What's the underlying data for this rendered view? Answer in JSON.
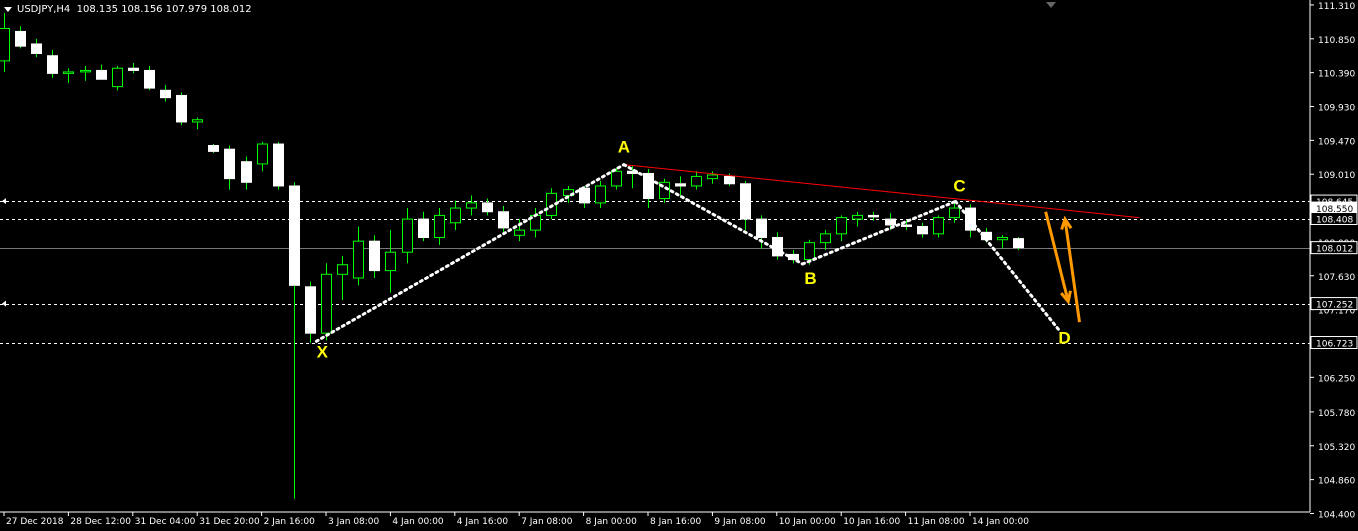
{
  "header": {
    "symbol": "USDJPY,H4",
    "ohlc": "108.135 108.156 107.979 108.012"
  },
  "colors": {
    "background": "#000000",
    "bull_fill": "#000000",
    "bull_outline": "#00ff00",
    "bear_fill": "#ffffff",
    "bear_outline": "#ffffff",
    "wick": "#00ff00",
    "pattern_dots": "#ffffff",
    "pattern_label": "#ffff00",
    "trendline": "#ff0000",
    "arrows": "#ff9900",
    "price_level_line": "#ffffff",
    "bid_line": "#777777",
    "axis_text": "#ffffff"
  },
  "chart_data": {
    "type": "candlestick",
    "symbol": "USDJPY",
    "timeframe": "H4",
    "ylim": [
      104.42,
      111.35
    ],
    "y_ticks": [
      "111.310",
      "110.850",
      "110.390",
      "109.930",
      "109.470",
      "109.010",
      "108.550",
      "108.090",
      "107.630",
      "107.170",
      "106.710",
      "106.250",
      "105.780",
      "105.320",
      "104.860",
      "104.400"
    ],
    "x_tick_labels": [
      "27 Dec 2018",
      "28 Dec 12:00",
      "31 Dec 04:00",
      "31 Dec 20:00",
      "2 Jan 16:00",
      "3 Jan 08:00",
      "4 Jan 00:00",
      "4 Jan 16:00",
      "7 Jan 08:00",
      "8 Jan 00:00",
      "8 Jan 16:00",
      "9 Jan 08:00",
      "10 Jan 00:00",
      "10 Jan 16:00",
      "11 Jan 08:00",
      "14 Jan 00:00"
    ],
    "price_labels": [
      "108.645",
      "108.550",
      "108.408",
      "108.012",
      "107.252",
      "106.723"
    ],
    "horizontal_levels": [
      108.645,
      108.408,
      107.252,
      106.723
    ],
    "bid": 108.012,
    "candles": [
      {
        "i": 0,
        "o": 110.55,
        "h": 111.2,
        "l": 110.4,
        "c": 110.99
      },
      {
        "i": 1,
        "o": 110.95,
        "h": 111.02,
        "l": 110.72,
        "c": 110.75
      },
      {
        "i": 2,
        "o": 110.78,
        "h": 110.85,
        "l": 110.6,
        "c": 110.65
      },
      {
        "i": 3,
        "o": 110.62,
        "h": 110.7,
        "l": 110.32,
        "c": 110.38
      },
      {
        "i": 4,
        "o": 110.38,
        "h": 110.45,
        "l": 110.25,
        "c": 110.4
      },
      {
        "i": 5,
        "o": 110.4,
        "h": 110.48,
        "l": 110.28,
        "c": 110.42
      },
      {
        "i": 6,
        "o": 110.42,
        "h": 110.5,
        "l": 110.3,
        "c": 110.3
      },
      {
        "i": 7,
        "o": 110.2,
        "h": 110.48,
        "l": 110.15,
        "c": 110.45
      },
      {
        "i": 8,
        "o": 110.45,
        "h": 110.52,
        "l": 110.38,
        "c": 110.42
      },
      {
        "i": 9,
        "o": 110.42,
        "h": 110.48,
        "l": 110.15,
        "c": 110.18
      },
      {
        "i": 10,
        "o": 110.15,
        "h": 110.22,
        "l": 110.0,
        "c": 110.05
      },
      {
        "i": 11,
        "o": 110.08,
        "h": 110.12,
        "l": 109.68,
        "c": 109.72
      },
      {
        "i": 12,
        "o": 109.72,
        "h": 109.78,
        "l": 109.62,
        "c": 109.75
      },
      {
        "i": 13,
        "o": 109.4,
        "h": 109.42,
        "l": 109.3,
        "c": 109.32
      },
      {
        "i": 14,
        "o": 109.35,
        "h": 109.4,
        "l": 108.8,
        "c": 108.95
      },
      {
        "i": 15,
        "o": 109.18,
        "h": 109.25,
        "l": 108.8,
        "c": 108.9
      },
      {
        "i": 16,
        "o": 109.15,
        "h": 109.45,
        "l": 109.05,
        "c": 109.42
      },
      {
        "i": 17,
        "o": 109.42,
        "h": 109.45,
        "l": 108.8,
        "c": 108.85
      },
      {
        "i": 18,
        "o": 108.85,
        "h": 108.9,
        "l": 104.6,
        "c": 107.5
      },
      {
        "i": 19,
        "o": 107.48,
        "h": 107.55,
        "l": 106.72,
        "c": 106.85
      },
      {
        "i": 20,
        "o": 106.85,
        "h": 107.8,
        "l": 106.75,
        "c": 107.65
      },
      {
        "i": 21,
        "o": 107.65,
        "h": 107.9,
        "l": 107.3,
        "c": 107.78
      },
      {
        "i": 22,
        "o": 107.6,
        "h": 108.3,
        "l": 107.5,
        "c": 108.1
      },
      {
        "i": 23,
        "o": 108.1,
        "h": 108.18,
        "l": 107.6,
        "c": 107.7
      },
      {
        "i": 24,
        "o": 107.7,
        "h": 108.25,
        "l": 107.4,
        "c": 107.95
      },
      {
        "i": 25,
        "o": 107.95,
        "h": 108.55,
        "l": 107.8,
        "c": 108.4
      },
      {
        "i": 26,
        "o": 108.4,
        "h": 108.5,
        "l": 108.1,
        "c": 108.15
      },
      {
        "i": 27,
        "o": 108.15,
        "h": 108.55,
        "l": 108.05,
        "c": 108.45
      },
      {
        "i": 28,
        "o": 108.35,
        "h": 108.65,
        "l": 108.25,
        "c": 108.55
      },
      {
        "i": 29,
        "o": 108.55,
        "h": 108.72,
        "l": 108.45,
        "c": 108.62
      },
      {
        "i": 30,
        "o": 108.62,
        "h": 108.68,
        "l": 108.45,
        "c": 108.5
      },
      {
        "i": 31,
        "o": 108.5,
        "h": 108.58,
        "l": 108.22,
        "c": 108.28
      },
      {
        "i": 32,
        "o": 108.18,
        "h": 108.4,
        "l": 108.1,
        "c": 108.25
      },
      {
        "i": 33,
        "o": 108.25,
        "h": 108.55,
        "l": 108.15,
        "c": 108.45
      },
      {
        "i": 34,
        "o": 108.45,
        "h": 108.82,
        "l": 108.4,
        "c": 108.75
      },
      {
        "i": 35,
        "o": 108.72,
        "h": 108.85,
        "l": 108.62,
        "c": 108.8
      },
      {
        "i": 36,
        "o": 108.82,
        "h": 108.85,
        "l": 108.55,
        "c": 108.62
      },
      {
        "i": 37,
        "o": 108.62,
        "h": 108.92,
        "l": 108.55,
        "c": 108.85
      },
      {
        "i": 38,
        "o": 108.85,
        "h": 109.1,
        "l": 108.8,
        "c": 109.05
      },
      {
        "i": 39,
        "o": 109.05,
        "h": 109.12,
        "l": 108.82,
        "c": 109.02
      },
      {
        "i": 40,
        "o": 109.02,
        "h": 109.08,
        "l": 108.55,
        "c": 108.68
      },
      {
        "i": 41,
        "o": 108.68,
        "h": 108.95,
        "l": 108.62,
        "c": 108.9
      },
      {
        "i": 42,
        "o": 108.88,
        "h": 108.98,
        "l": 108.72,
        "c": 108.85
      },
      {
        "i": 43,
        "o": 108.85,
        "h": 109.05,
        "l": 108.8,
        "c": 108.98
      },
      {
        "i": 44,
        "o": 108.95,
        "h": 109.05,
        "l": 108.88,
        "c": 109.0
      },
      {
        "i": 45,
        "o": 108.98,
        "h": 109.02,
        "l": 108.85,
        "c": 108.88
      },
      {
        "i": 46,
        "o": 108.88,
        "h": 108.92,
        "l": 108.25,
        "c": 108.4
      },
      {
        "i": 47,
        "o": 108.4,
        "h": 108.45,
        "l": 108.0,
        "c": 108.15
      },
      {
        "i": 48,
        "o": 108.15,
        "h": 108.22,
        "l": 107.85,
        "c": 107.9
      },
      {
        "i": 49,
        "o": 107.92,
        "h": 107.98,
        "l": 107.8,
        "c": 107.85
      },
      {
        "i": 50,
        "o": 107.85,
        "h": 108.12,
        "l": 107.78,
        "c": 108.08
      },
      {
        "i": 51,
        "o": 108.08,
        "h": 108.25,
        "l": 107.98,
        "c": 108.2
      },
      {
        "i": 52,
        "o": 108.2,
        "h": 108.45,
        "l": 108.1,
        "c": 108.42
      },
      {
        "i": 53,
        "o": 108.4,
        "h": 108.5,
        "l": 108.3,
        "c": 108.45
      },
      {
        "i": 54,
        "o": 108.45,
        "h": 108.5,
        "l": 108.38,
        "c": 108.43
      },
      {
        "i": 55,
        "o": 108.4,
        "h": 108.48,
        "l": 108.25,
        "c": 108.32
      },
      {
        "i": 56,
        "o": 108.32,
        "h": 108.38,
        "l": 108.25,
        "c": 108.3
      },
      {
        "i": 57,
        "o": 108.3,
        "h": 108.35,
        "l": 108.15,
        "c": 108.2
      },
      {
        "i": 58,
        "o": 108.2,
        "h": 108.45,
        "l": 108.15,
        "c": 108.42
      },
      {
        "i": 59,
        "o": 108.42,
        "h": 108.62,
        "l": 108.35,
        "c": 108.55
      },
      {
        "i": 60,
        "o": 108.55,
        "h": 108.6,
        "l": 108.15,
        "c": 108.25
      },
      {
        "i": 61,
        "o": 108.22,
        "h": 108.28,
        "l": 108.08,
        "c": 108.12
      },
      {
        "i": 62,
        "o": 108.12,
        "h": 108.18,
        "l": 108.0,
        "c": 108.15
      },
      {
        "i": 63,
        "o": 108.135,
        "h": 108.156,
        "l": 107.979,
        "c": 108.012
      }
    ],
    "pattern": {
      "name": "XABCD",
      "points": [
        {
          "label": "X",
          "i": 19.4,
          "price": 106.74
        },
        {
          "label": "A",
          "i": 38.5,
          "price": 109.14
        },
        {
          "label": "B",
          "i": 49.6,
          "price": 107.79
        },
        {
          "label": "C",
          "i": 59.1,
          "price": 108.64
        },
        {
          "label": "D",
          "i": 65.5,
          "price": 106.9
        }
      ]
    },
    "trendline": {
      "from": {
        "i": 38.5,
        "price": 109.14
      },
      "to": {
        "i": 70.5,
        "price": 108.42
      }
    },
    "arrows": [
      {
        "from": {
          "i": 64.7,
          "price": 108.5
        },
        "to": {
          "i": 66.1,
          "price": 107.28
        },
        "direction": "down"
      },
      {
        "from": {
          "i": 66.8,
          "price": 107.0
        },
        "to": {
          "i": 65.9,
          "price": 108.4
        },
        "direction": "up"
      }
    ]
  }
}
